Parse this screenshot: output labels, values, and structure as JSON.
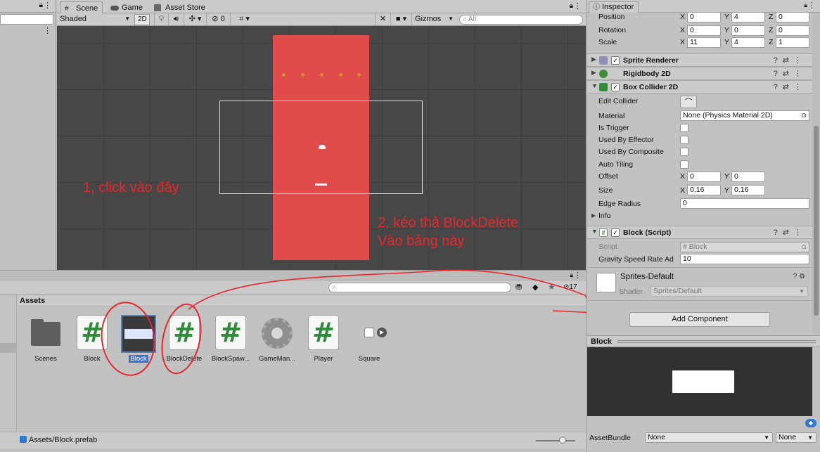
{
  "scene_tabs": [
    {
      "label": "Scene",
      "icon": "hash-grid-icon"
    },
    {
      "label": "Game",
      "icon": "gamepad-icon"
    },
    {
      "label": "Asset Store",
      "icon": "store-bag-icon"
    }
  ],
  "scene_toolbar": {
    "shading": "Shaded",
    "mode_2d": "2D",
    "hidden_count": "0",
    "gizmos": "Gizmos",
    "search_placeholder": "All"
  },
  "annotations": {
    "step1": "1, click vào đây",
    "step2_line1": "2, kéo thả BlockDelete",
    "step2_line2": "Vào bảng này"
  },
  "project": {
    "breadcrumb": "Assets",
    "count": "17",
    "status_path": "Assets/Block.prefab",
    "assets": [
      {
        "name": "Scenes",
        "type": "folder"
      },
      {
        "name": "Block",
        "type": "script"
      },
      {
        "name": "Block",
        "type": "prefab",
        "selected": true
      },
      {
        "name": "BlockDelete",
        "type": "script"
      },
      {
        "name": "BlockSpaw...",
        "type": "script"
      },
      {
        "name": "GameMan...",
        "type": "gear"
      },
      {
        "name": "Player",
        "type": "script"
      },
      {
        "name": "Square",
        "type": "sprite"
      }
    ]
  },
  "inspector": {
    "tab": "Inspector",
    "transform": {
      "position": {
        "label": "Position",
        "x": "0",
        "y": "4",
        "z": "0"
      },
      "rotation": {
        "label": "Rotation",
        "x": "0",
        "y": "0",
        "z": "0"
      },
      "scale": {
        "label": "Scale",
        "x": "11",
        "y": "4",
        "z": "1"
      }
    },
    "axes": {
      "x": "X",
      "y": "Y",
      "z": "Z"
    },
    "components": {
      "sprite_renderer": "Sprite Renderer",
      "rigidbody": "Rigidbody 2D",
      "box_collider": "Box Collider 2D",
      "block_script": "Block (Script)"
    },
    "collider": {
      "edit_collider": "Edit Collider",
      "material_label": "Material",
      "material_value": "None (Physics Material 2D)",
      "is_trigger": "Is Trigger",
      "used_by_effector": "Used By Effector",
      "used_by_composite": "Used By Composite",
      "auto_tiling": "Auto Tiling",
      "offset_label": "Offset",
      "offset_x": "0",
      "offset_y": "0",
      "size_label": "Size",
      "size_x": "0.16",
      "size_y": "0.16",
      "edge_radius_label": "Edge Radius",
      "edge_radius": "0",
      "info": "Info"
    },
    "script": {
      "script_label": "Script",
      "script_value": "Block",
      "gravity_label": "Gravity Speed Rate Ad",
      "gravity_value": "10"
    },
    "material": {
      "name": "Sprites-Default",
      "shader_label": "Shader",
      "shader_value": "Sprites/Default"
    },
    "add_component": "Add Component"
  },
  "preview": {
    "title": "Block"
  },
  "asset_bundle": {
    "label": "AssetBundle",
    "value": "None",
    "variant": "None"
  }
}
